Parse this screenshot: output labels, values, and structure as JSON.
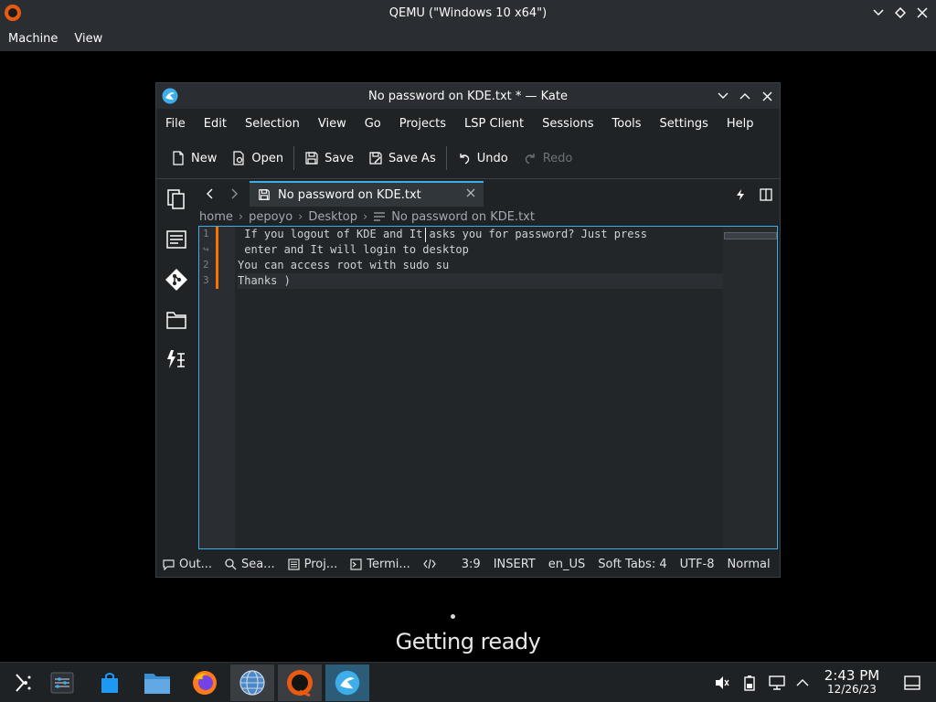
{
  "qemu": {
    "title": "QEMU (\"Windows 10 x64\")",
    "menu": [
      "Machine",
      "View"
    ]
  },
  "kate": {
    "title": "No password on KDE.txt * — Kate",
    "menu": [
      "File",
      "Edit",
      "Selection",
      "View",
      "Go",
      "Projects",
      "LSP Client",
      "Sessions",
      "Tools",
      "Settings",
      "Help"
    ],
    "toolbar": {
      "new": "New",
      "open": "Open",
      "save": "Save",
      "save_as": "Save As",
      "undo": "Undo",
      "redo": "Redo"
    },
    "tab": {
      "label": "No password on KDE.txt"
    },
    "breadcrumb": [
      "home",
      "pepoyo",
      "Desktop",
      "No password on KDE.txt"
    ],
    "lines": [
      {
        "num": "1",
        "text": " If you logout of KDE and It asks you for password? Just press"
      },
      {
        "num": "↪",
        "text": " enter and It will login to desktop"
      },
      {
        "num": "2",
        "text": "You can access root with sudo su"
      },
      {
        "num": "3",
        "text": "Thanks )"
      }
    ],
    "statusbar": {
      "output": "Out...",
      "search": "Sea...",
      "projects": "Proj...",
      "terminal": "Termi...",
      "position": "3:9",
      "mode": "INSERT",
      "language": "en_US",
      "tabs": "Soft Tabs: 4",
      "encoding": "UTF-8",
      "input_mode": "Normal"
    }
  },
  "overlay": {
    "text": "Getting ready"
  },
  "taskbar": {
    "time": "2:43 PM",
    "date": "12/26/23"
  },
  "colors": {
    "accent": "#3daee9",
    "modified": "#f67400",
    "window_bg": "#202326"
  }
}
